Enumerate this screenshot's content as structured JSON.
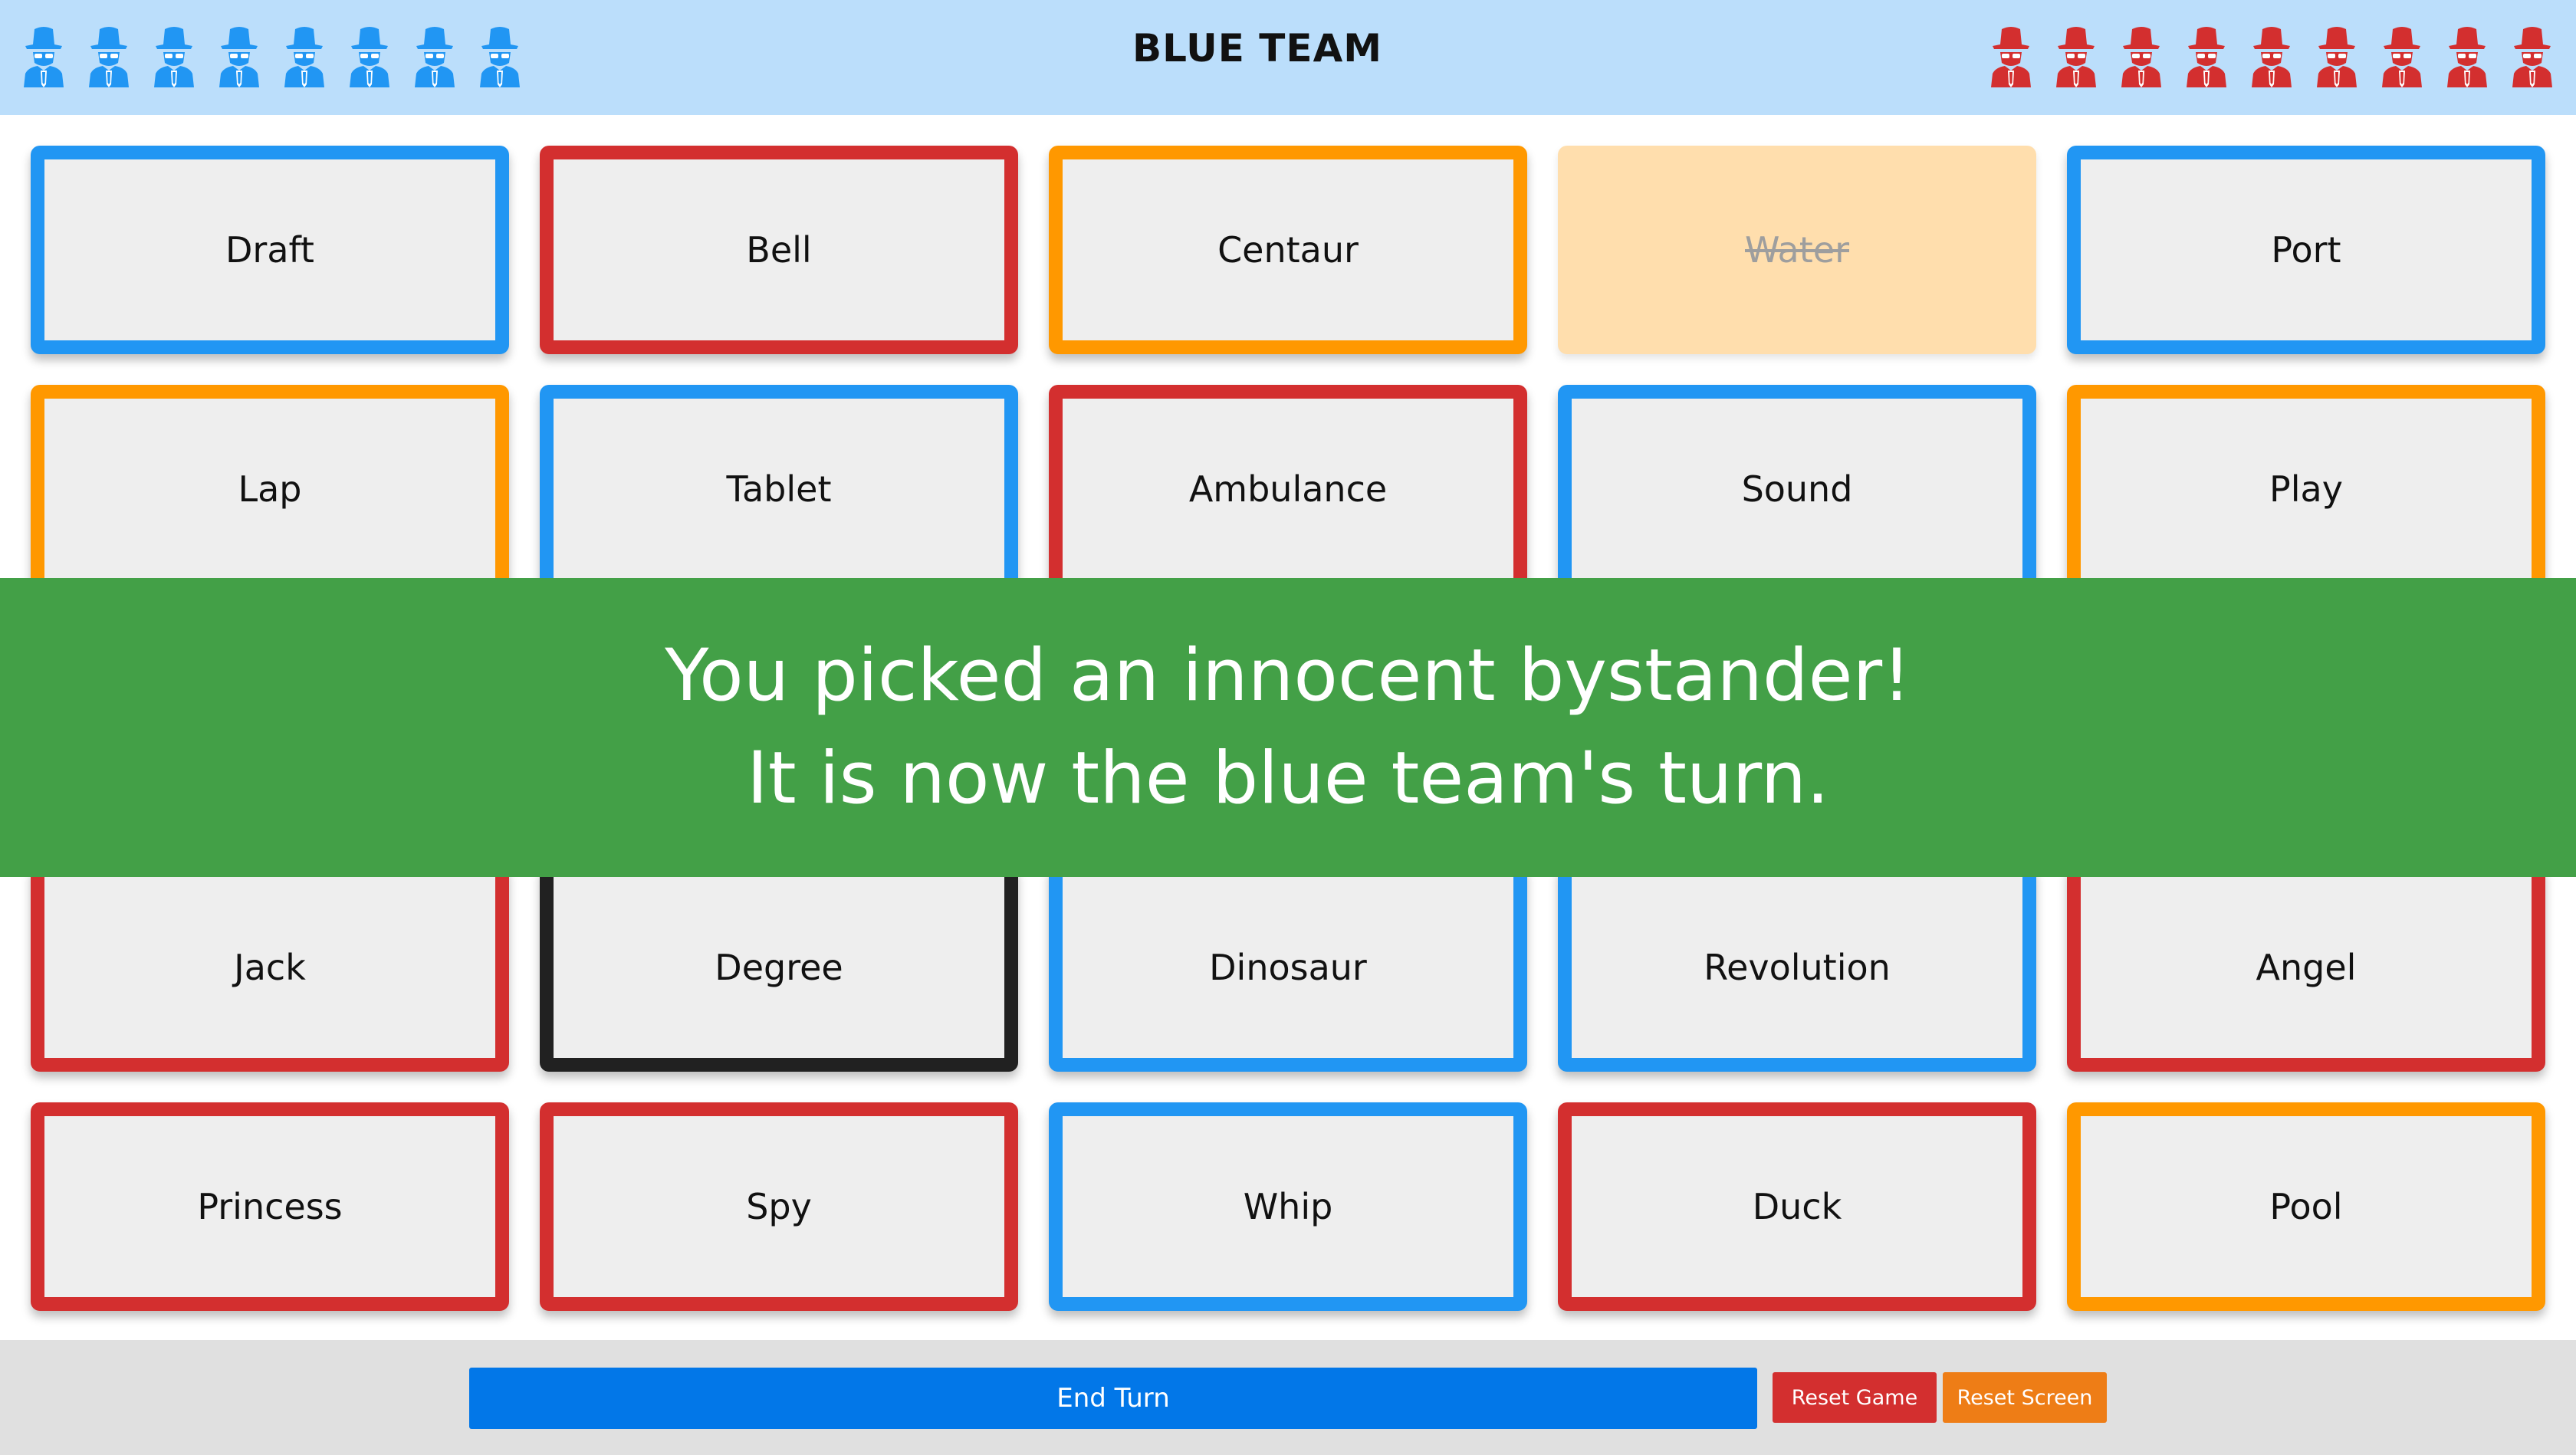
{
  "header": {
    "title": "BLUE TEAM",
    "blue_agents_remaining": 8,
    "red_agents_remaining": 9,
    "agent_icon": "spy-agent-icon",
    "colors": {
      "blue": "#2196f3",
      "red": "#d32f2f",
      "background": "#bbdefb"
    }
  },
  "board": {
    "cards": [
      {
        "word": "Draft",
        "team": "blue",
        "revealed": false
      },
      {
        "word": "Bell",
        "team": "red",
        "revealed": false
      },
      {
        "word": "Centaur",
        "team": "neutral",
        "revealed": false
      },
      {
        "word": "Water",
        "team": "neutral",
        "revealed": true
      },
      {
        "word": "Port",
        "team": "blue",
        "revealed": false
      },
      {
        "word": "Lap",
        "team": "neutral",
        "revealed": false
      },
      {
        "word": "Tablet",
        "team": "blue",
        "revealed": false
      },
      {
        "word": "Ambulance",
        "team": "red",
        "revealed": false
      },
      {
        "word": "Sound",
        "team": "blue",
        "revealed": false
      },
      {
        "word": "Play",
        "team": "neutral",
        "revealed": false
      },
      {
        "word": "",
        "team": "blue",
        "revealed": false
      },
      {
        "word": "",
        "team": "red",
        "revealed": false
      },
      {
        "word": "",
        "team": "blue",
        "revealed": false
      },
      {
        "word": "",
        "team": "red",
        "revealed": false
      },
      {
        "word": "",
        "team": "blue",
        "revealed": false
      },
      {
        "word": "Jack",
        "team": "red",
        "revealed": false
      },
      {
        "word": "Degree",
        "team": "assassin",
        "revealed": false
      },
      {
        "word": "Dinosaur",
        "team": "blue",
        "revealed": false
      },
      {
        "word": "Revolution",
        "team": "blue",
        "revealed": false
      },
      {
        "word": "Angel",
        "team": "red",
        "revealed": false
      },
      {
        "word": "Princess",
        "team": "red",
        "revealed": false
      },
      {
        "word": "Spy",
        "team": "red",
        "revealed": false
      },
      {
        "word": "Whip",
        "team": "blue",
        "revealed": false
      },
      {
        "word": "Duck",
        "team": "red",
        "revealed": false
      },
      {
        "word": "Pool",
        "team": "neutral",
        "revealed": false
      }
    ]
  },
  "banner": {
    "line1": "You picked an innocent bystander!",
    "line2": "It is now the blue team's turn.",
    "color": "#43a047"
  },
  "footer": {
    "end_turn_label": "End Turn",
    "reset_game_label": "Reset Game",
    "reset_screen_label": "Reset Screen"
  }
}
